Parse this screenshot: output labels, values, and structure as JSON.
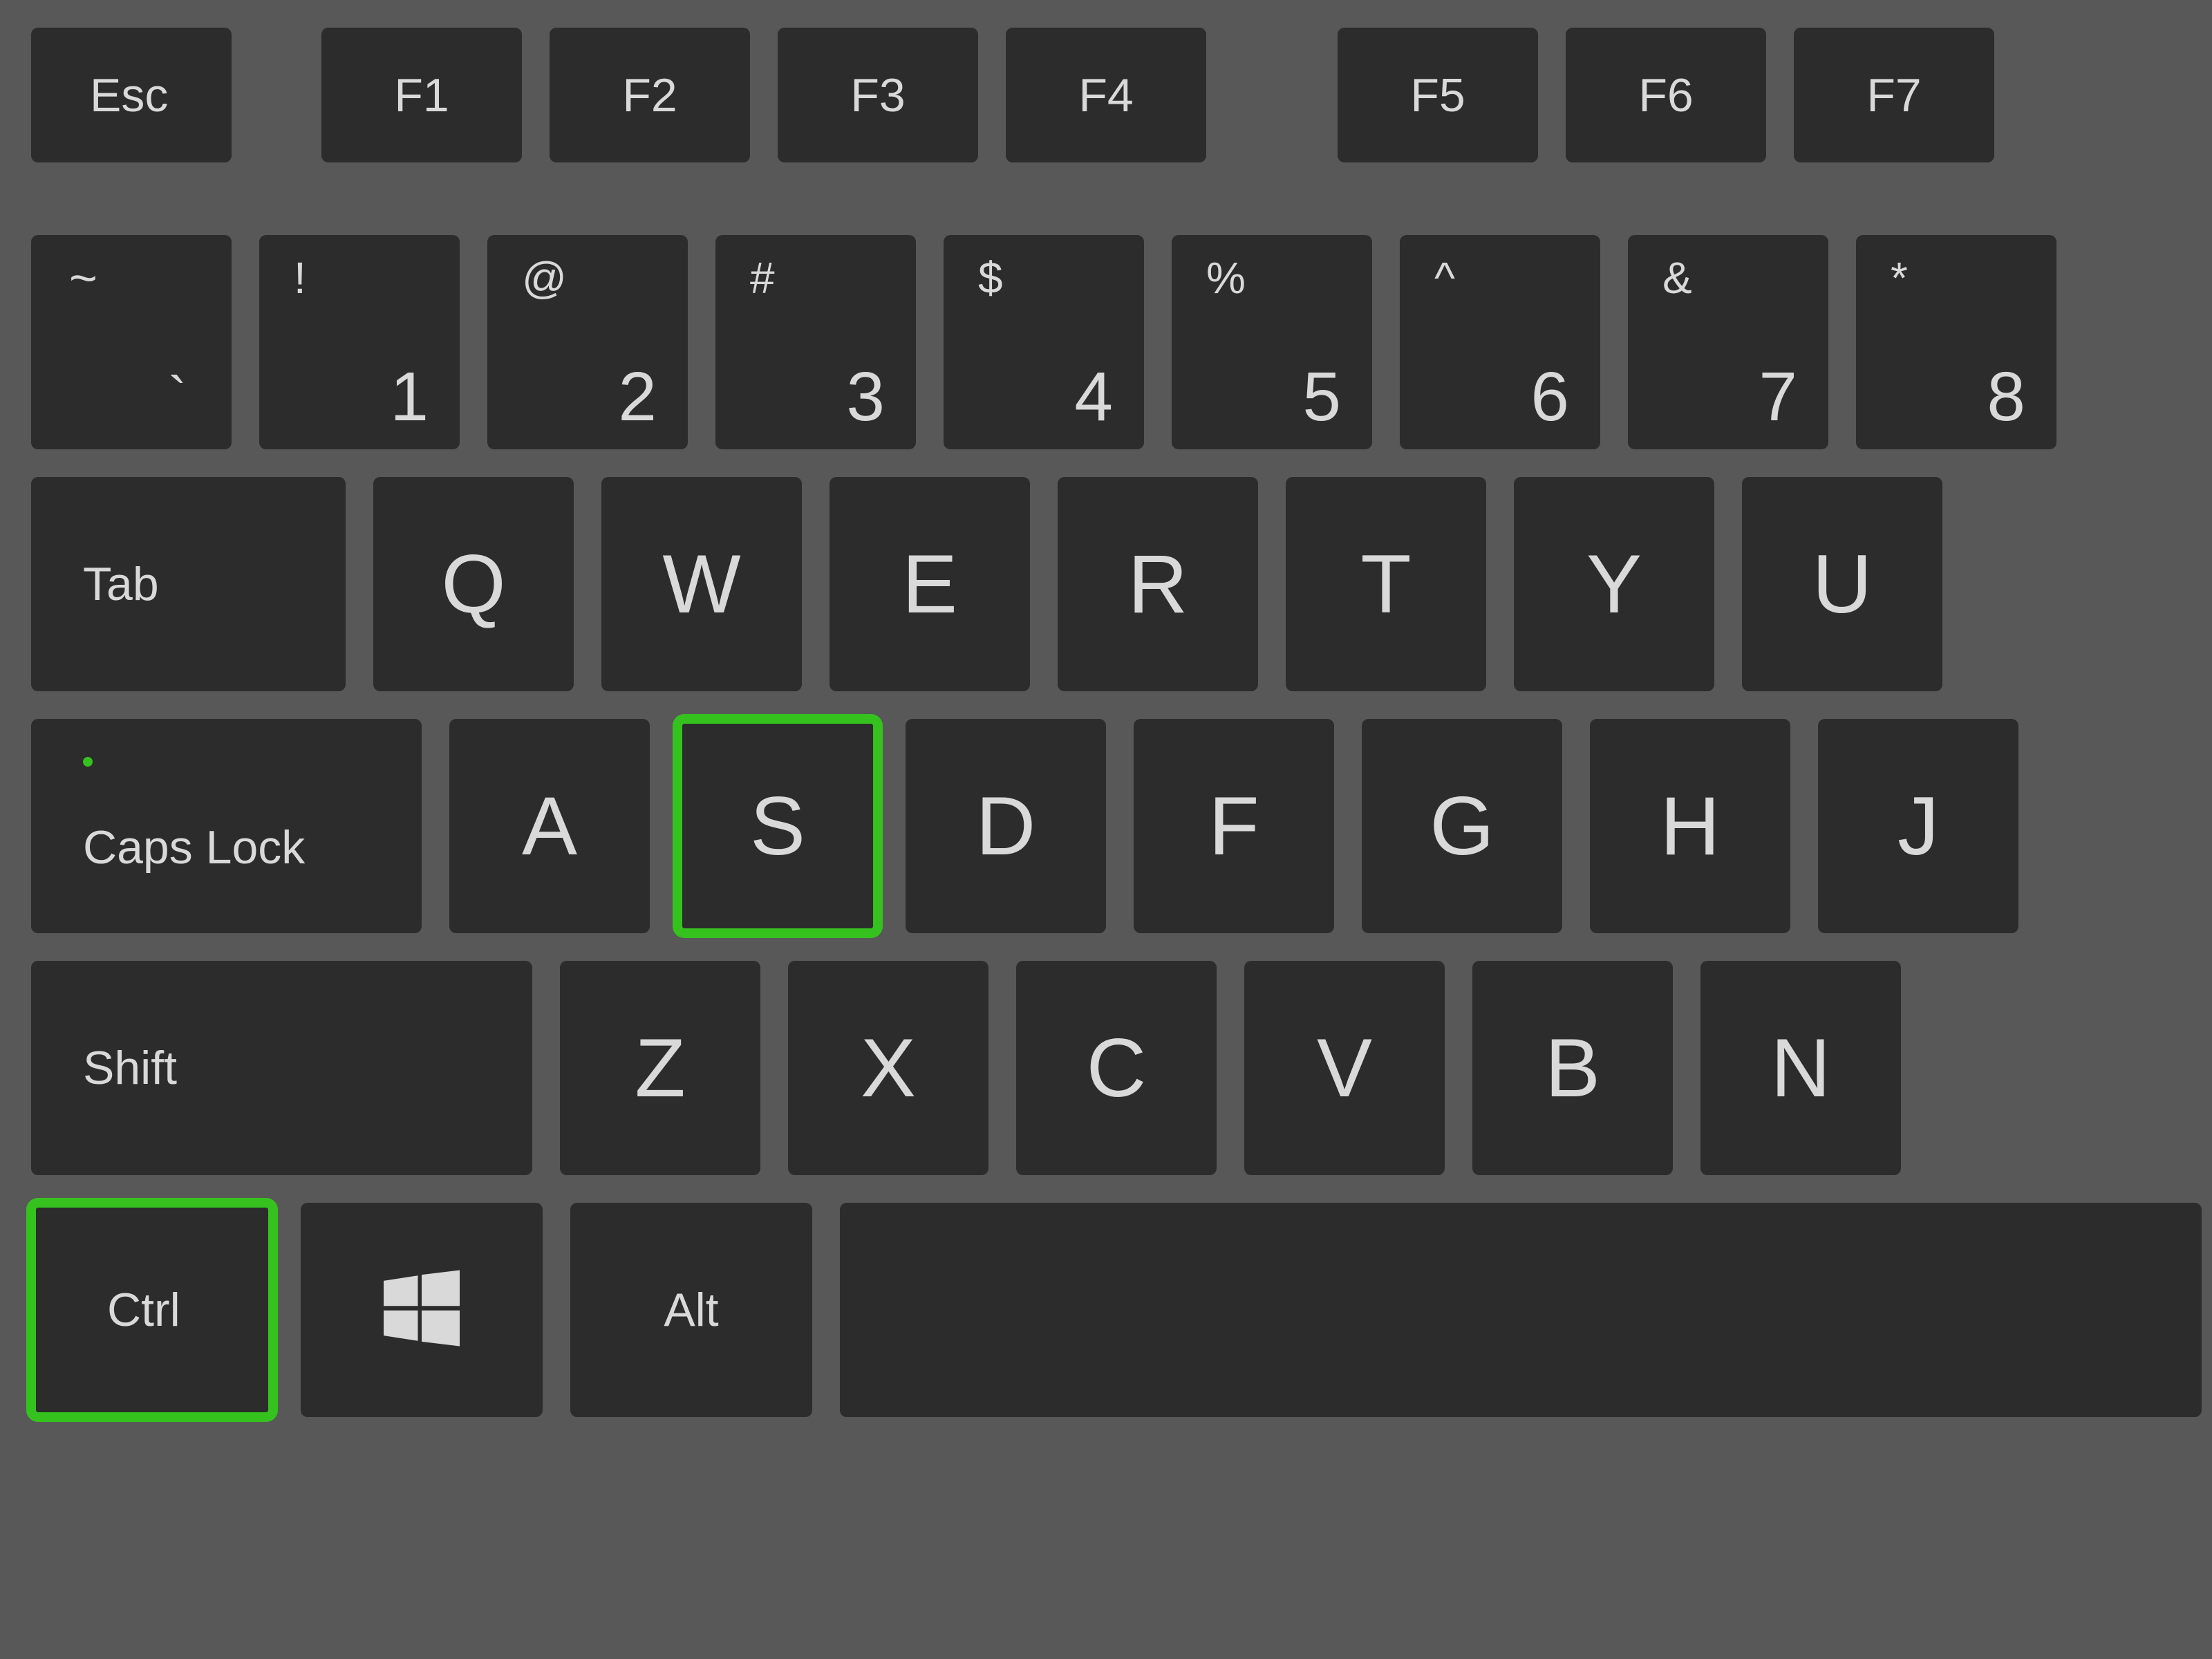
{
  "colors": {
    "background": "#585858",
    "key": "#2c2c2c",
    "text": "#d9d9d9",
    "highlight": "#35c21f",
    "caps_led": "#35c21f"
  },
  "highlighted_keys": [
    "S",
    "Ctrl"
  ],
  "rows": {
    "function": {
      "esc": "Esc",
      "keys": [
        "F1",
        "F2",
        "F3",
        "F4",
        "F5",
        "F6",
        "F7"
      ]
    },
    "number": [
      {
        "upper": "~",
        "lower": "`"
      },
      {
        "upper": "!",
        "lower": "1"
      },
      {
        "upper": "@",
        "lower": "2"
      },
      {
        "upper": "#",
        "lower": "3"
      },
      {
        "upper": "$",
        "lower": "4"
      },
      {
        "upper": "%",
        "lower": "5"
      },
      {
        "upper": "^",
        "lower": "6"
      },
      {
        "upper": "&",
        "lower": "7"
      },
      {
        "upper": "*",
        "lower": "8"
      }
    ],
    "qwerty": {
      "tab": "Tab",
      "letters": [
        "Q",
        "W",
        "E",
        "R",
        "T",
        "Y",
        "U"
      ]
    },
    "home": {
      "caps": "Caps Lock",
      "letters": [
        "A",
        "S",
        "D",
        "F",
        "G",
        "H",
        "J"
      ]
    },
    "shift": {
      "shift": "Shift",
      "letters": [
        "Z",
        "X",
        "C",
        "V",
        "B",
        "N"
      ]
    },
    "bottom": {
      "ctrl": "Ctrl",
      "win": "windows-logo",
      "alt": "Alt",
      "space": ""
    }
  }
}
